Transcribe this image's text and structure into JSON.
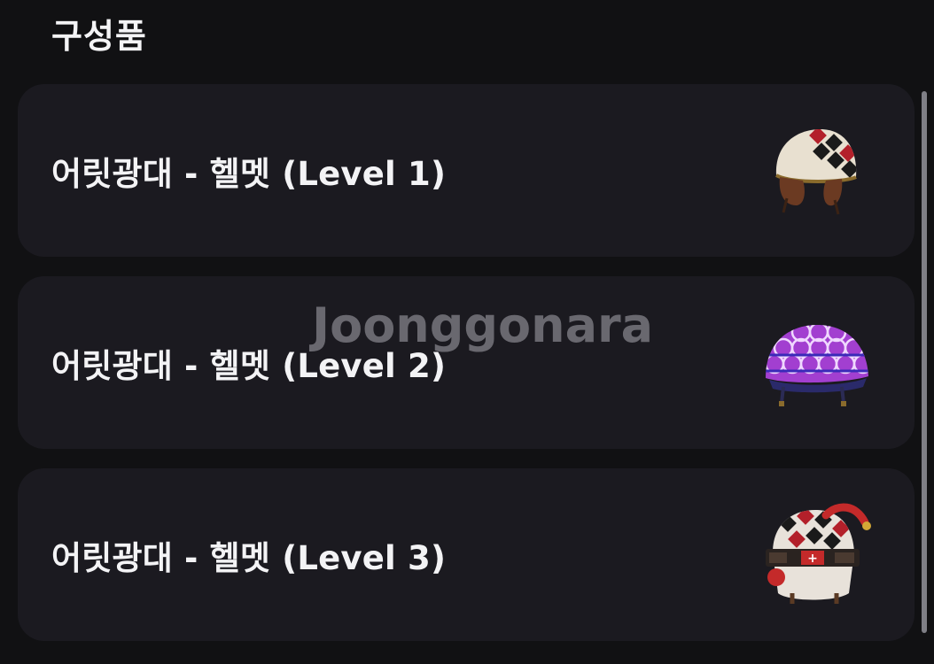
{
  "section": {
    "title": "구성품"
  },
  "items": [
    {
      "name": "어릿광대 - 헬멧 (Level 1)",
      "image_icon": "level1-helmet-icon"
    },
    {
      "name": "어릿광대 - 헬멧 (Level 2)",
      "image_icon": "level2-helmet-icon"
    },
    {
      "name": "어릿광대 - 헬멧 (Level 3)",
      "image_icon": "level3-helmet-icon"
    }
  ],
  "watermark": {
    "text": "Joonggonara"
  },
  "colors": {
    "background": "#111113",
    "card": "#1b1a20",
    "text": "#f3f3f5",
    "scrollbar": "#7f7f86"
  }
}
